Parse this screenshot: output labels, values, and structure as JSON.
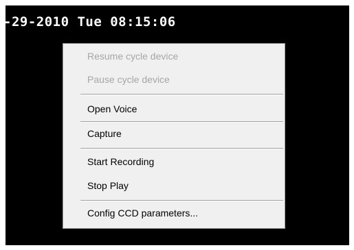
{
  "video": {
    "timestamp": "-29-2010 Tue 08:15:06"
  },
  "context_menu": {
    "items": [
      {
        "label": "Resume cycle device",
        "enabled": false
      },
      {
        "label": "Pause cycle device",
        "enabled": false
      },
      {
        "label": "Open Voice",
        "enabled": true
      },
      {
        "label": "Capture",
        "enabled": true
      },
      {
        "label": "Start Recording",
        "enabled": true
      },
      {
        "label": "Stop Play",
        "enabled": true
      },
      {
        "label": "Config CCD parameters...",
        "enabled": true
      }
    ]
  },
  "colors": {
    "menu_background": "#f0f0f0",
    "disabled_text": "#a6a6a6",
    "video_background": "#000000",
    "osd_text": "#ffffff"
  }
}
